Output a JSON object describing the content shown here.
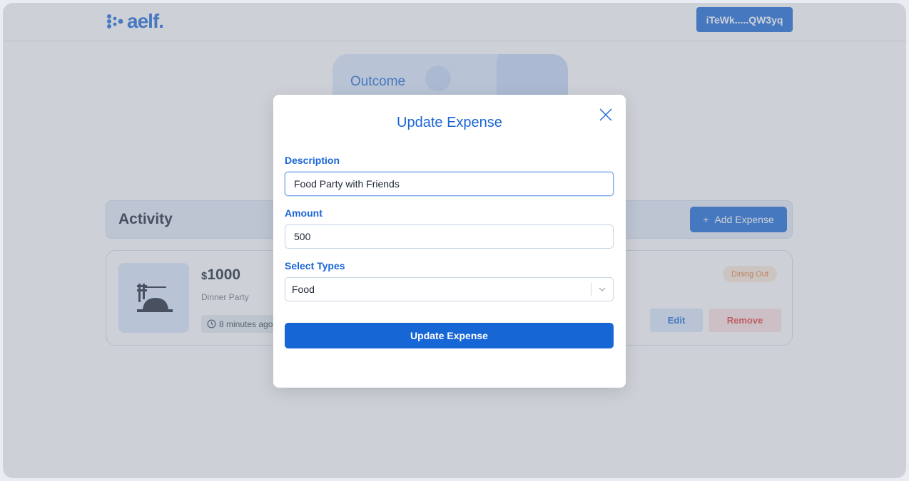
{
  "header": {
    "logo_text": "aelf.",
    "wallet_label": "iTeWk.....QW3yq"
  },
  "outcome": {
    "label": "Outcome"
  },
  "activity": {
    "title": "Activity",
    "add_label": "Add Expense",
    "add_icon": "+"
  },
  "expense": {
    "currency": "$",
    "amount": "1000",
    "description": "Dinner Party",
    "time": "8 minutes ago",
    "tag": "Dining Out",
    "edit_label": "Edit",
    "remove_label": "Remove",
    "icon": "dining-icon"
  },
  "modal": {
    "title": "Update Expense",
    "description_label": "Description",
    "description_value": "Food Party with Friends",
    "amount_label": "Amount",
    "amount_value": "500",
    "types_label": "Select Types",
    "types_value": "Food",
    "submit_label": "Update Expense"
  },
  "colors": {
    "accent": "#1766d6",
    "tag_bg": "#fde8d8",
    "tag_text": "#e07a3c",
    "remove_text": "#e23b3b"
  }
}
